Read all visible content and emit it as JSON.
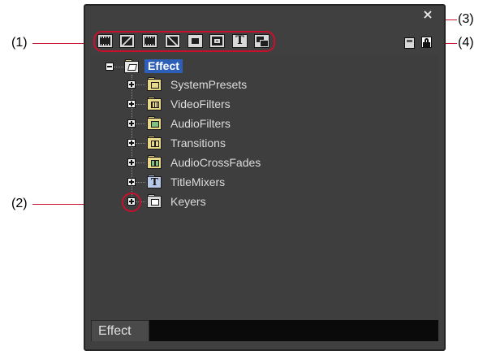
{
  "callouts": {
    "c1": "(1)",
    "c2": "(2)",
    "c3": "(3)",
    "c4": "(4)"
  },
  "window": {
    "close_glyph": "×",
    "bottom_tab": "Effect"
  },
  "toolbar": {
    "buttons": [
      {
        "name": "video-filter-icon",
        "glyph": ""
      },
      {
        "name": "transition-icon",
        "glyph": ""
      },
      {
        "name": "audio-filter-icon",
        "glyph": ""
      },
      {
        "name": "audio-crossfade-icon",
        "glyph": ""
      },
      {
        "name": "keyer-icon",
        "glyph": ""
      },
      {
        "name": "keyer-alt-icon",
        "glyph": ""
      },
      {
        "name": "title-mixer-icon",
        "glyph": "T"
      },
      {
        "name": "overlay-icon",
        "glyph": ""
      }
    ]
  },
  "tree": {
    "root": "Effect",
    "items": [
      {
        "label": "SystemPresets",
        "badge": "#e8d98a"
      },
      {
        "label": "VideoFilters",
        "badge": "#e8d98a"
      },
      {
        "label": "AudioFilters",
        "badge": "#7fc07f"
      },
      {
        "label": "Transitions",
        "badge": "#e8d98a"
      },
      {
        "label": "AudioCrossFades",
        "badge": "#7fc07f"
      },
      {
        "label": "TitleMixers",
        "badge": "#b8c8e8",
        "glyph": "T"
      },
      {
        "label": "Keyers",
        "badge": "#d8d8d8"
      }
    ]
  },
  "colors": {
    "accent": "#c8102e",
    "selection": "#2d5fb8",
    "window_bg": "#404040"
  }
}
